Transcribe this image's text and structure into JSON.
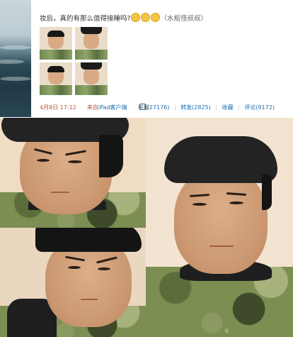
{
  "post": {
    "text": "妆后，真的有那么值得接睡吗?",
    "emoji_count": 3,
    "emoji_icon": "smiley-face",
    "tail": "（水瓶怪叔叔）",
    "time": "4月8日 17:12",
    "source_prefix": "来自",
    "source": "iPad客户端",
    "report": "举报",
    "likes": "(27176)",
    "repost": "转发(2825)",
    "favorite": "收藏",
    "comment": "评论(9172)"
  },
  "photos": {
    "watermark": "©"
  },
  "colors": {
    "link": "#1a6fb3",
    "time": "#b55d3b",
    "emoji": "#f4c542"
  }
}
